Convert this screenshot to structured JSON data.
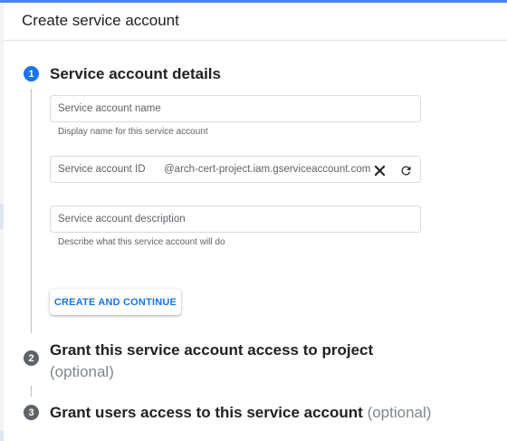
{
  "header": {
    "title": "Create service account"
  },
  "steps": [
    {
      "number": "1",
      "title": "Service account details"
    },
    {
      "number": "2",
      "title": "Grant this service account access to project",
      "optional": "(optional)"
    },
    {
      "number": "3",
      "title": "Grant users access to this service account",
      "optional": "(optional)"
    }
  ],
  "form": {
    "name_field": {
      "label": "Service account name",
      "hint": "Display name for this service account"
    },
    "id_field": {
      "label": "Service account ID",
      "suffix": "@arch-cert-project.iam.gserviceaccount.com"
    },
    "description_field": {
      "label": "Service account description",
      "hint": "Describe what this service account will do"
    },
    "submit_label": "CREATE AND CONTINUE"
  },
  "icons": {
    "clear": "close-icon",
    "regenerate": "refresh-icon"
  },
  "colors": {
    "accent": "#1a73e8",
    "step_inactive": "#5f6368",
    "optional_text": "#80868b"
  }
}
